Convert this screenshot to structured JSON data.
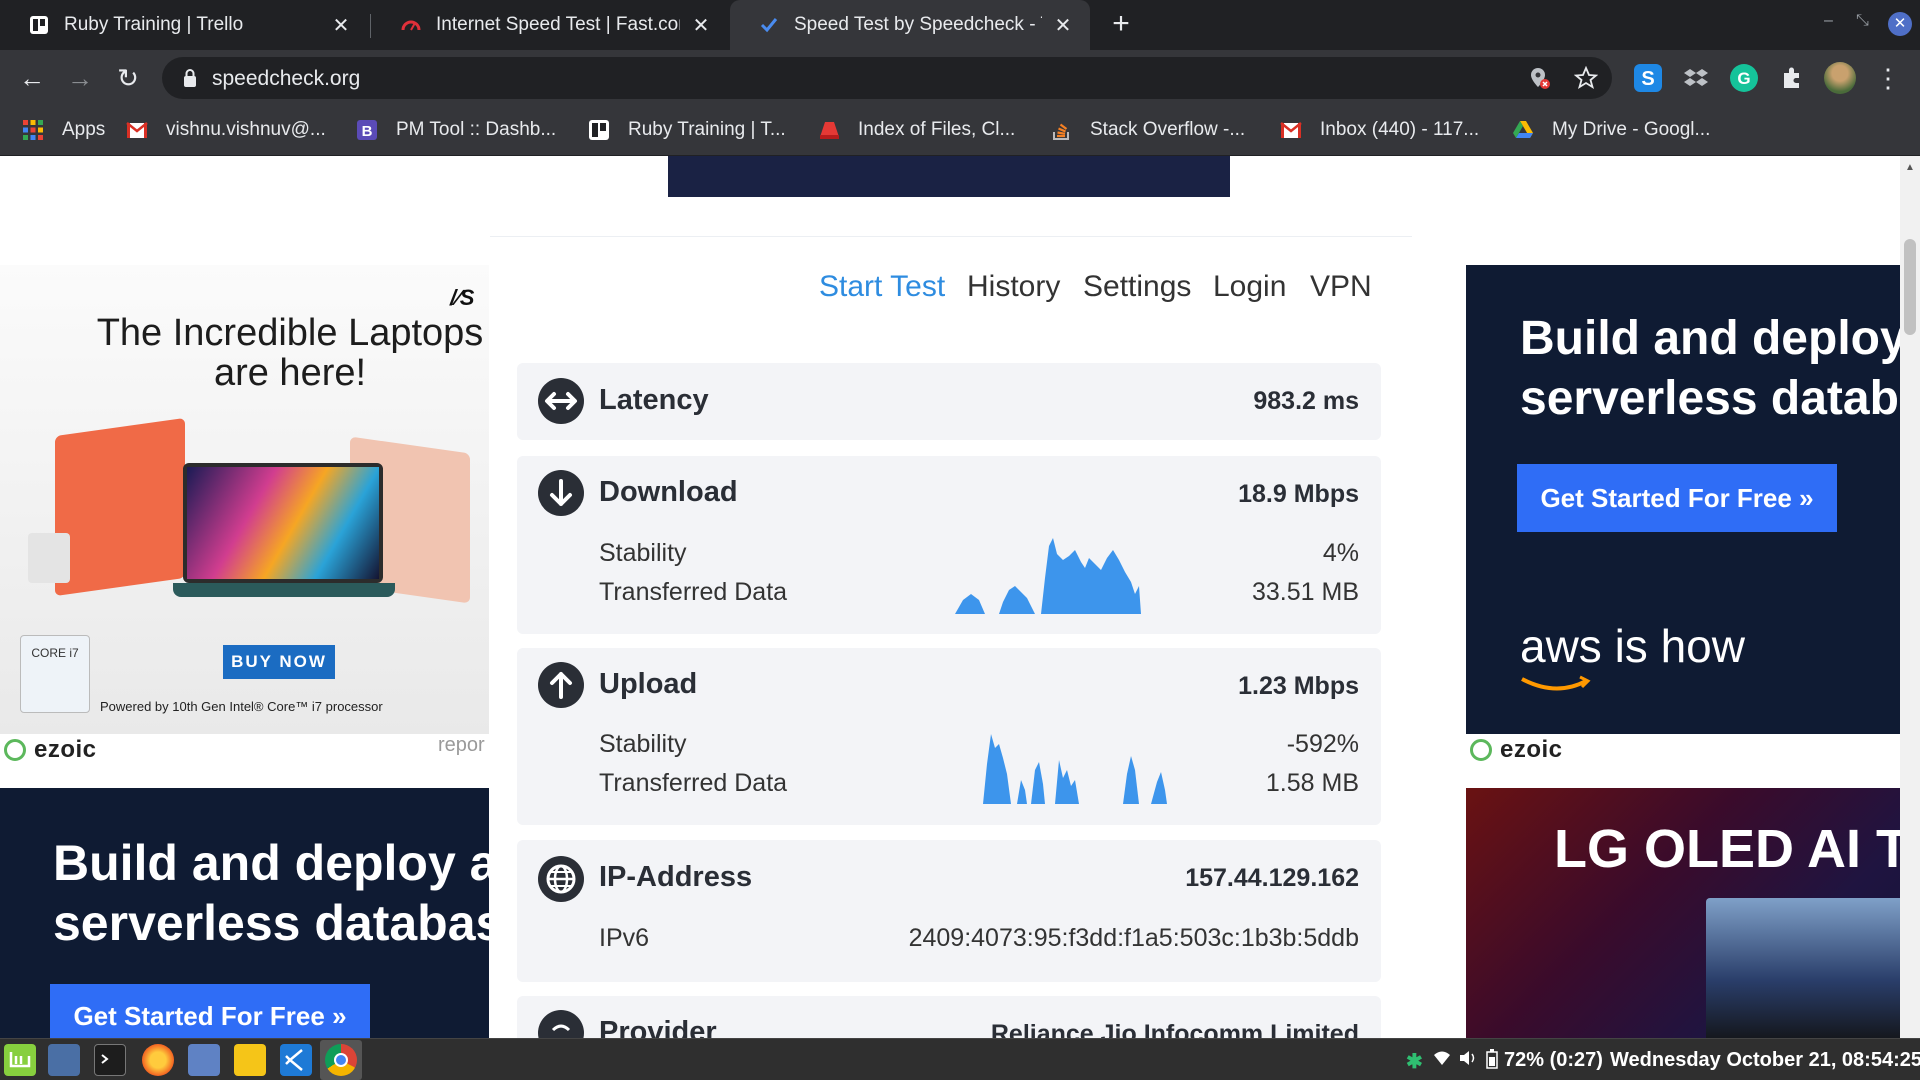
{
  "browser": {
    "tabs": [
      {
        "title": "Ruby Training | Trello",
        "icon": "trello-icon",
        "active": false
      },
      {
        "title": "Internet Speed Test | Fast.com",
        "icon": "fast-com-icon",
        "active": false
      },
      {
        "title": "Speed Test by Speedcheck - Te",
        "icon": "speedcheck-check-icon",
        "active": true
      }
    ],
    "new_tab": "+",
    "url": "speedcheck.org",
    "bookmarks": [
      {
        "label": "Apps",
        "icon": "apps-grid-icon"
      },
      {
        "label": "vishnu.vishnuv@...",
        "icon": "gmail-icon"
      },
      {
        "label": "PM Tool :: Dashb...",
        "icon": "pm-tool-icon"
      },
      {
        "label": "Ruby Training | T...",
        "icon": "trello-icon"
      },
      {
        "label": "Index of Files, Cl...",
        "icon": "folder-icon"
      },
      {
        "label": "Stack Overflow -...",
        "icon": "stackoverflow-icon"
      },
      {
        "label": "Inbox (440) - 117...",
        "icon": "gmail-icon"
      },
      {
        "label": "My Drive - Googl...",
        "icon": "google-drive-icon"
      }
    ]
  },
  "ads": {
    "laptop": {
      "brand": "/∕S",
      "headline_line1": "The Incredible Laptops",
      "headline_line2": "are here!",
      "button": "BUY NOW",
      "intel_badge": "CORE i7",
      "powered_by": "Powered by 10th Gen Intel® Core™ i7 processor"
    },
    "ezoic_label": "ezoic",
    "report_label": "repor",
    "aws_right": {
      "line1": "Build and deploy",
      "line2": "serverless datab",
      "cta": "Get Started For Free »",
      "tagline": "aws is how"
    },
    "aws_left": {
      "line1": "Build and deploy a",
      "line2": "serverless databas",
      "cta": "Get Started For Free »"
    },
    "lg": {
      "headline": "LG OLED AI Th"
    }
  },
  "speedtest": {
    "nav": [
      {
        "label": "Start Test",
        "active": true
      },
      {
        "label": "History",
        "active": false
      },
      {
        "label": "Settings",
        "active": false
      },
      {
        "label": "Login",
        "active": false
      },
      {
        "label": "VPN",
        "active": false
      }
    ],
    "latency": {
      "label": "Latency",
      "value": "983.2 ms"
    },
    "download": {
      "label": "Download",
      "value": "18.9 Mbps",
      "stability_label": "Stability",
      "stability_value": "4%",
      "transferred_label": "Transferred Data",
      "transferred_value": "33.51 MB"
    },
    "upload": {
      "label": "Upload",
      "value": "1.23 Mbps",
      "stability_label": "Stability",
      "stability_value": "-592%",
      "transferred_label": "Transferred Data",
      "transferred_value": "1.58 MB"
    },
    "ip": {
      "label": "IP-Address",
      "value": "157.44.129.162",
      "ipv6_label": "IPv6",
      "ipv6_value": "2409:4073:95:f3dd:f1a5:503c:1b3b:5ddb"
    },
    "provider": {
      "label": "Provider",
      "value": "Reliance Jio Infocomm Limited"
    }
  },
  "colors": {
    "accent_blue": "#2e8ce0",
    "spark_blue": "#3d95ec",
    "card_bg": "#f3f4f7"
  },
  "taskbar": {
    "battery": "72% (0:27)",
    "datetime": "Wednesday October 21, 08:54:25"
  }
}
